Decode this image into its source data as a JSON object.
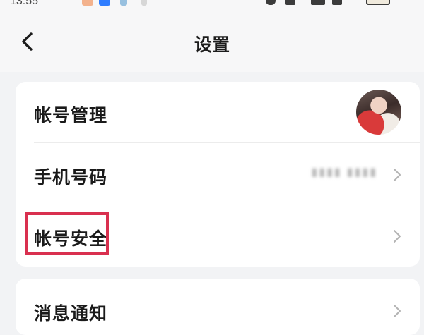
{
  "status_bar": {
    "time": "13:55"
  },
  "header": {
    "title": "设置"
  },
  "settings": {
    "group1": [
      {
        "label": "帐号管理"
      },
      {
        "label": "手机号码",
        "value": "▮▮▮▮  ▮▮▮▮"
      },
      {
        "label": "帐号安全"
      }
    ],
    "group2": [
      {
        "label": "消息通知"
      }
    ]
  },
  "colors": {
    "highlight": "#d9304f",
    "card_background": "#ffffff",
    "page_background": "#f2f3f5"
  },
  "icons": {
    "back": "chevron-left-icon",
    "row_arrow": "chevron-right-icon"
  }
}
